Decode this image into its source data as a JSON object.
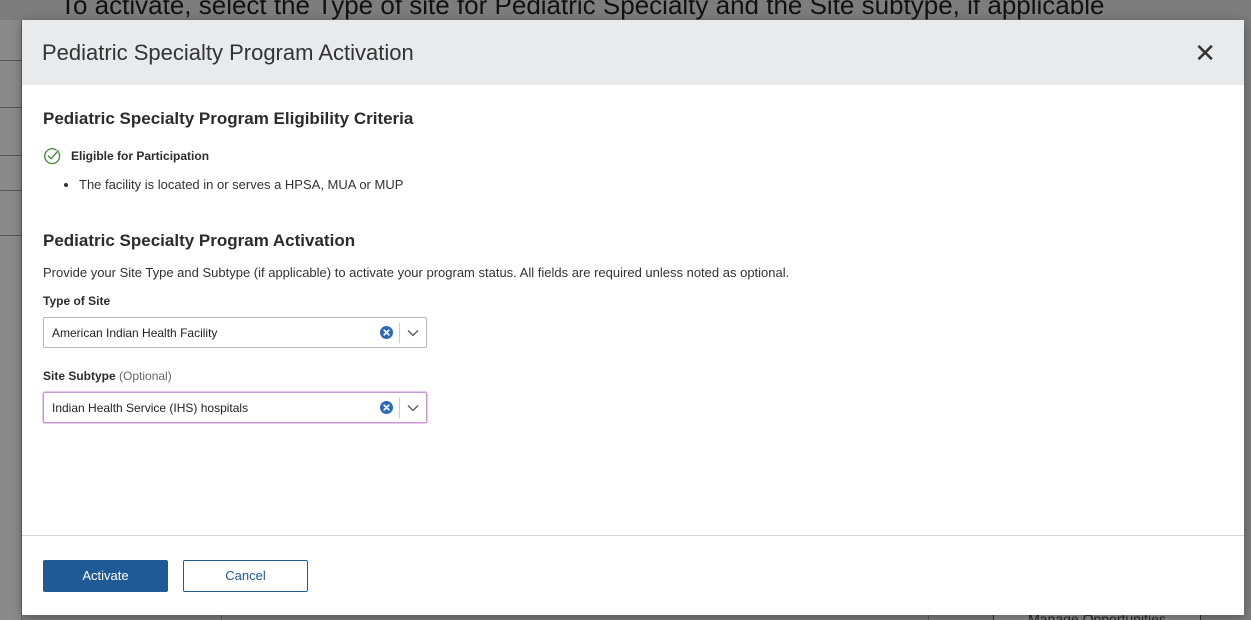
{
  "background": {
    "top_text": "To activate, select the Type of site for Pediatric Specialty and the Site subtype, if applicable",
    "button_label": "Manage Opportunities"
  },
  "modal": {
    "title": "Pediatric Specialty Program Activation",
    "close_icon": "close-icon"
  },
  "eligibility": {
    "heading": "Pediatric Specialty Program Eligibility Criteria",
    "status_icon": "check-circle-icon",
    "status_label": "Eligible for Participation",
    "criteria": [
      "The facility is located in or serves a HPSA, MUA or MUP"
    ]
  },
  "activation": {
    "heading": "Pediatric Specialty Program Activation",
    "instructions": "Provide your Site Type and Subtype (if applicable) to activate your program status. All fields are required unless noted as optional.",
    "site_type": {
      "label": "Type of Site",
      "value": "American Indian Health Facility"
    },
    "site_subtype": {
      "label": "Site Subtype",
      "optional_text": "(Optional)",
      "value": "Indian Health Service (IHS) hospitals"
    }
  },
  "footer": {
    "activate_label": "Activate",
    "cancel_label": "Cancel"
  },
  "colors": {
    "primary": "#1f5a96",
    "success": "#4a8a3c",
    "focus_border": "#c79ad3",
    "header_bg": "#e8eaec"
  }
}
